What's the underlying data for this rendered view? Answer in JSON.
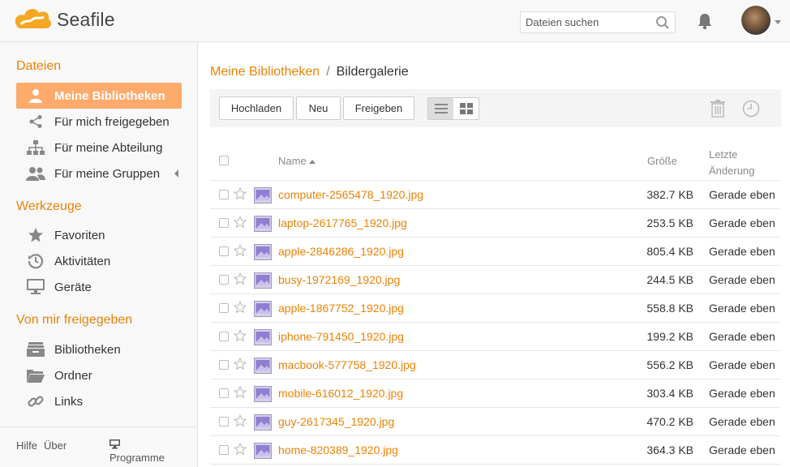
{
  "header": {
    "logo_text": "Seafile",
    "search_placeholder": "Dateien suchen"
  },
  "sidebar": {
    "section_files": "Dateien",
    "files_items": [
      {
        "label": "Meine Bibliotheken",
        "icon": "user-icon",
        "active": true
      },
      {
        "label": "Für mich freigegeben",
        "icon": "share-icon"
      },
      {
        "label": "Für meine Abteilung",
        "icon": "org-chart-icon"
      },
      {
        "label": "Für meine Gruppen",
        "icon": "group-icon"
      }
    ],
    "section_tools": "Werkzeuge",
    "tools_items": [
      {
        "label": "Favoriten",
        "icon": "star-icon"
      },
      {
        "label": "Aktivitäten",
        "icon": "history-icon"
      },
      {
        "label": "Geräte",
        "icon": "monitor-icon"
      }
    ],
    "section_shared": "Von mir freigegeben",
    "shared_items": [
      {
        "label": "Bibliotheken",
        "icon": "library-icon"
      },
      {
        "label": "Ordner",
        "icon": "folder-icon"
      },
      {
        "label": "Links",
        "icon": "link-icon"
      }
    ],
    "footer": {
      "help": "Hilfe",
      "about": "Über",
      "programs": "Programme"
    }
  },
  "breadcrumb": {
    "root": "Meine Bibliotheken",
    "separator": "/",
    "current": "Bildergalerie"
  },
  "toolbar": {
    "upload": "Hochladen",
    "new": "Neu",
    "share": "Freigeben"
  },
  "table": {
    "col_name": "Name",
    "col_size": "Größe",
    "col_modified_line1": "Letzte",
    "col_modified_line2": "Änderung",
    "rows": [
      {
        "name": "computer-2565478_1920.jpg",
        "size": "382.7 KB",
        "modified": "Gerade eben"
      },
      {
        "name": "laptop-2617765_1920.jpg",
        "size": "253.5 KB",
        "modified": "Gerade eben"
      },
      {
        "name": "apple-2846286_1920.jpg",
        "size": "805.4 KB",
        "modified": "Gerade eben"
      },
      {
        "name": "busy-1972169_1920.jpg",
        "size": "244.5 KB",
        "modified": "Gerade eben"
      },
      {
        "name": "apple-1867752_1920.jpg",
        "size": "558.8 KB",
        "modified": "Gerade eben"
      },
      {
        "name": "iphone-791450_1920.jpg",
        "size": "199.2 KB",
        "modified": "Gerade eben"
      },
      {
        "name": "macbook-577758_1920.jpg",
        "size": "556.2 KB",
        "modified": "Gerade eben"
      },
      {
        "name": "mobile-616012_1920.jpg",
        "size": "303.4 KB",
        "modified": "Gerade eben"
      },
      {
        "name": "guy-2617345_1920.jpg",
        "size": "470.2 KB",
        "modified": "Gerade eben"
      },
      {
        "name": "home-820389_1920.jpg",
        "size": "364.3 KB",
        "modified": "Gerade eben"
      }
    ]
  },
  "colors": {
    "accent": "#eb8205",
    "active_bg": "#fdaa6b"
  }
}
